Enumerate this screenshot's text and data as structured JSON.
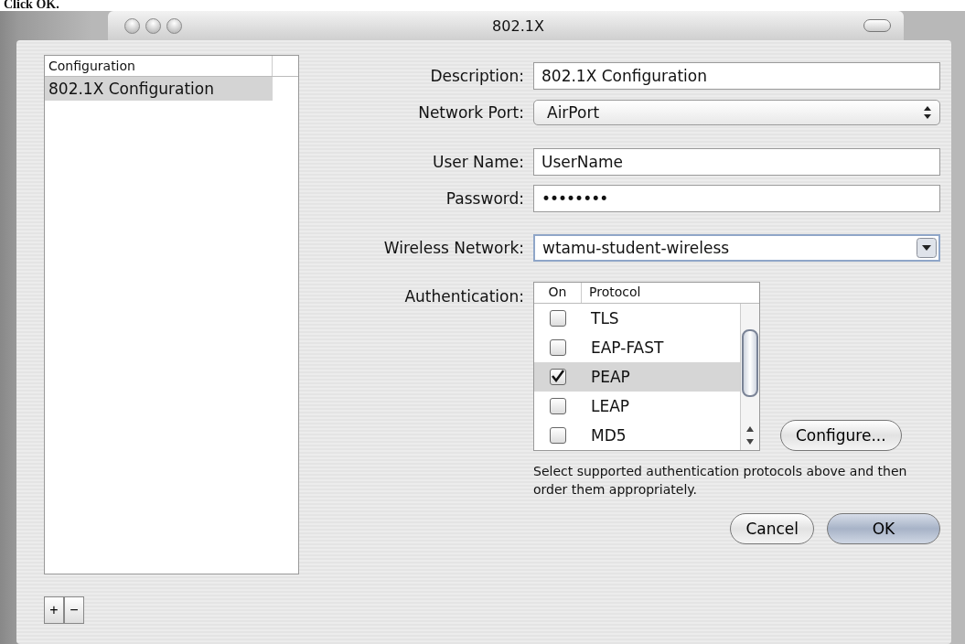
{
  "caption": "Click OK.",
  "window": {
    "title": "802.1X"
  },
  "configurations": {
    "header": "Configuration",
    "items": [
      {
        "label": "802.1X Configuration",
        "selected": true
      }
    ],
    "add_button": "+",
    "remove_button": "−"
  },
  "fields": [
    {
      "kind": "text",
      "label": "Description:",
      "value": "802.1X Configuration"
    },
    {
      "kind": "popup",
      "label": "Network Port:",
      "value": "AirPort"
    },
    {
      "kind": "text",
      "label": "User Name:",
      "value": "UserName"
    },
    {
      "kind": "password",
      "label": "Password:",
      "value": "••••••••"
    },
    {
      "kind": "combo",
      "label": "Wireless Network:",
      "value": "wtamu-student-wireless"
    }
  ],
  "authentication": {
    "label": "Authentication:",
    "columns": [
      "On",
      "Protocol"
    ],
    "rows": [
      {
        "protocol": "TLS",
        "checked": false,
        "selected": false
      },
      {
        "protocol": "EAP-FAST",
        "checked": false,
        "selected": false
      },
      {
        "protocol": "PEAP",
        "checked": true,
        "selected": true
      },
      {
        "protocol": "LEAP",
        "checked": false,
        "selected": false
      },
      {
        "protocol": "MD5",
        "checked": false,
        "selected": false
      }
    ],
    "configure_button": "Configure...",
    "help": "Select supported authentication protocols above and then order them appropriately."
  },
  "buttons": [
    {
      "label": "Cancel",
      "default": false
    },
    {
      "label": "OK",
      "default": true
    }
  ]
}
